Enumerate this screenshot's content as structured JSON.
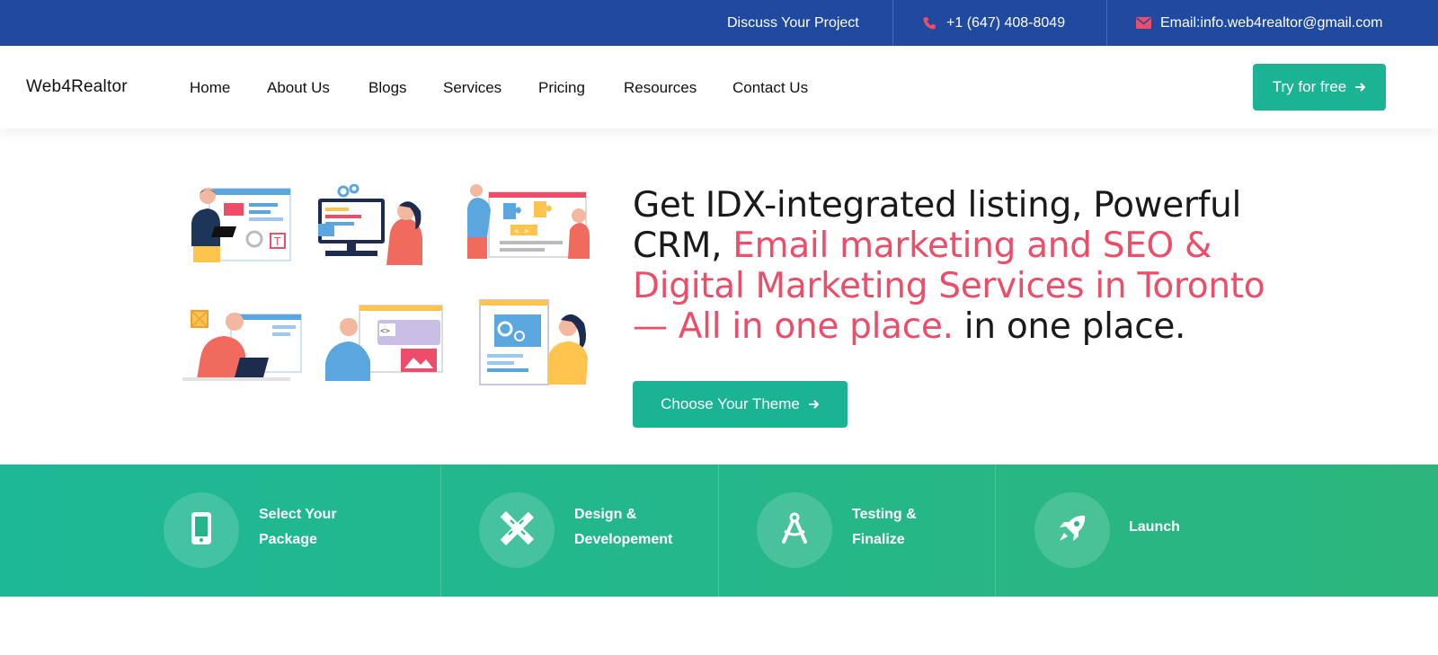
{
  "topbar": {
    "discuss": "Discuss Your Project",
    "phone": "+1 (647) 408-8049",
    "email": "Email:info.web4realtor@gmail.com",
    "icons": [
      "phone-icon",
      "envelope-icon"
    ],
    "icon_color": "#ec4d69",
    "bg_color": "#1f4aa0"
  },
  "header": {
    "logo": "Web4Realtor",
    "nav": [
      "Home",
      "About Us",
      "Blogs",
      "Services",
      "Pricing",
      "Resources",
      "Contact Us"
    ],
    "cta_label": "Try for free"
  },
  "hero": {
    "headline_part1": "Get IDX-integrated listing, Powerful CRM, ",
    "headline_accent": "Email marketing and SEO & Digital Marketing Services in Toronto — All in one place.",
    "headline_part2": " in one place.",
    "button_label": "Choose Your Theme",
    "accent_color": "#ec4d69",
    "button_color": "#1ab394"
  },
  "steps": [
    {
      "label_line1": "Select Your",
      "label_line2": "Package",
      "icon": "mobile-icon"
    },
    {
      "label_line1": "Design &",
      "label_line2": "Developement",
      "icon": "pencil-ruler-icon"
    },
    {
      "label_line1": "Testing &",
      "label_line2": "Finalize",
      "icon": "compass-icon"
    },
    {
      "label_line1": "Launch",
      "label_line2": "",
      "icon": "rocket-icon"
    }
  ]
}
